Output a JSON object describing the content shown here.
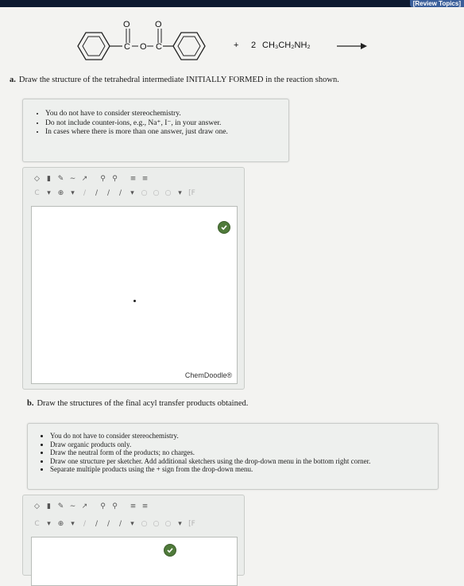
{
  "header": {
    "review_topics": "[Review Topics]"
  },
  "reaction": {
    "ester_label": "O O ‖ ‖ -C-O-C-",
    "plus": "+",
    "coefficient": "2",
    "amine": "CH₃CH₂NH₂"
  },
  "part_a": {
    "letter": "a.",
    "prompt": "Draw the structure of the tetrahedral intermediate INITIALLY FORMED in the reaction shown.",
    "instructions": [
      "You do not have to consider stereochemistry.",
      "Do not include counter-ions, e.g., Na⁺, I⁻, in your answer.",
      "In cases where there is more than one answer, just draw one."
    ]
  },
  "part_b": {
    "letter": "b.",
    "prompt": "Draw the structures of the final acyl transfer products obtained.",
    "instructions": [
      "You do not have to consider stereochemistry.",
      "Draw organic products only.",
      "Draw the neutral form of the products; no charges.",
      "Draw one structure per sketcher. Add additional sketchers using the drop-down menu in the bottom right corner.",
      "Separate multiple products using the + sign from the drop-down menu."
    ]
  },
  "sketcher": {
    "brand": "ChemDoodle®",
    "toolbar_top_icons": [
      "bond-icon",
      "erase-icon",
      "pencil-icon",
      "lasso-icon",
      "arrow-icon",
      "zoom-in-icon",
      "zoom-out-icon",
      "template-icon",
      "clean-icon"
    ],
    "toolbar_bottom_icons": [
      "element-C",
      "dropdown",
      "charge-icon",
      "dropdown",
      "single-bond",
      "double-bond",
      "triple-bond",
      "bond-dropdown",
      "ring-icon",
      "ring-icon",
      "ring-icon",
      "dropdown",
      "text-icon"
    ]
  },
  "colors": {
    "check_green": "#4f7a3a",
    "topbar": "#0d1a30"
  }
}
